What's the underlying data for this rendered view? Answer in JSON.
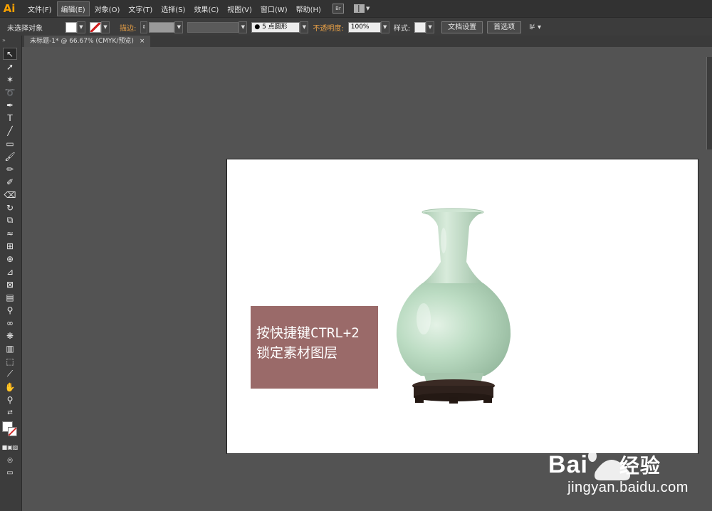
{
  "app": {
    "logo": "Ai"
  },
  "menu": [
    "文件(F)",
    "编辑(E)",
    "对象(O)",
    "文字(T)",
    "选择(S)",
    "效果(C)",
    "视图(V)",
    "窗口(W)",
    "帮助(H)"
  ],
  "menu_active_index": 1,
  "menu_extra": {
    "bridge_label": "Br"
  },
  "control_bar": {
    "selection_status": "未选择对象",
    "stroke_label": "描边:",
    "brush_value": "5 点圆形",
    "opacity_label": "不透明度:",
    "opacity_value": "100%",
    "style_label": "样式:",
    "doc_setup_button": "文档设置",
    "preferences_button": "首选项"
  },
  "document_tab": {
    "title": "未标题-1* @ 66.67% (CMYK/预览)",
    "close": "×"
  },
  "artboard": {
    "note_line1": "按快捷键CTRL+2",
    "note_line2": "锁定素材图层",
    "note_color": "#9a6a69"
  },
  "watermark": {
    "brand": "Bai",
    "brand_cn": "经验",
    "url": "jingyan.baidu.com"
  },
  "tools": [
    "selection-tool",
    "direct-selection-tool",
    "magic-wand-tool",
    "lasso-tool",
    "pen-tool",
    "type-tool",
    "line-tool",
    "rectangle-tool",
    "paintbrush-tool",
    "pencil-tool",
    "blob-brush-tool",
    "eraser-tool",
    "rotate-tool",
    "scale-tool",
    "warp-tool",
    "free-transform-tool",
    "shape-builder-tool",
    "perspective-grid-tool",
    "mesh-tool",
    "gradient-tool",
    "eyedropper-tool",
    "blend-tool",
    "symbol-sprayer-tool",
    "column-graph-tool",
    "artboard-tool",
    "slice-tool",
    "hand-tool",
    "zoom-tool"
  ]
}
